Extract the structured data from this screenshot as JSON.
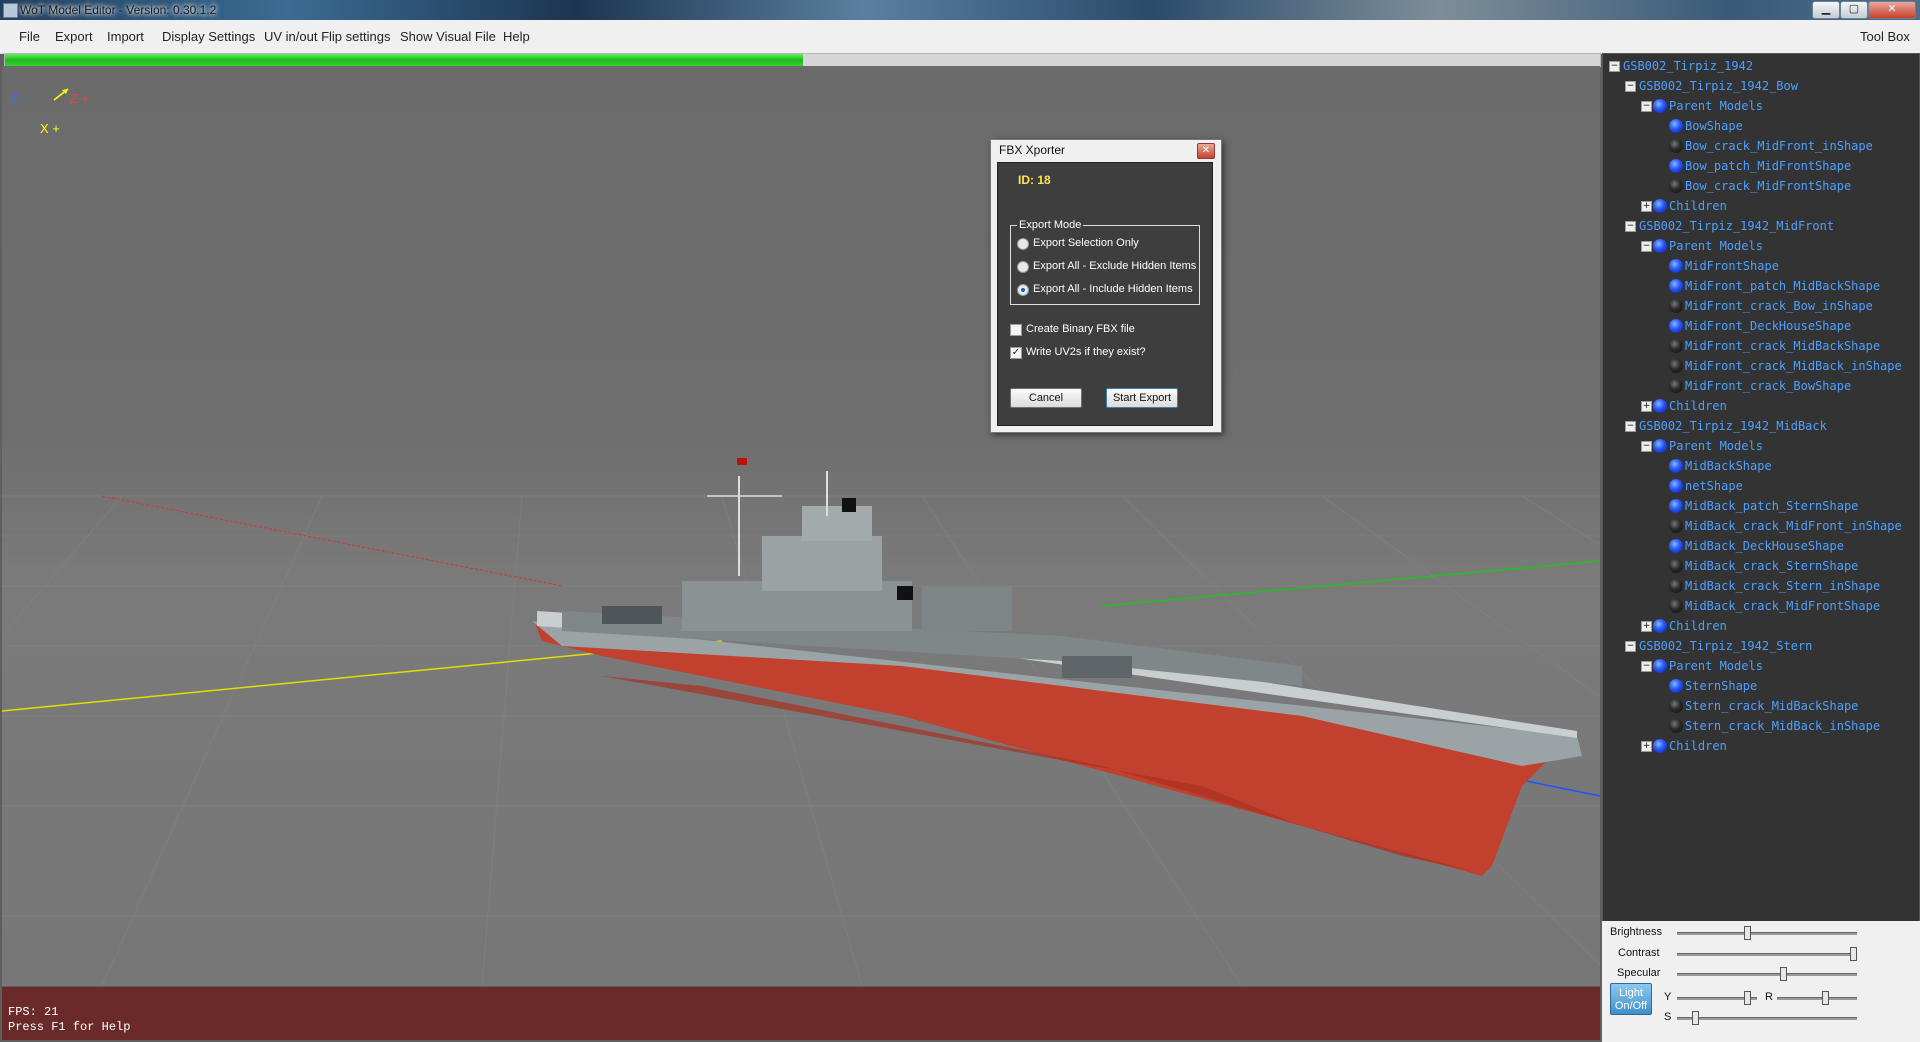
{
  "window": {
    "title": "WoT Model Editor - Version: 0.30.1.2"
  },
  "menu": {
    "items": [
      "File",
      "Export",
      "Import",
      "Display Settings",
      "UV in/out Flip settings",
      "Show Visual File",
      "Help"
    ],
    "toolbox": "Tool Box"
  },
  "progress": {
    "fraction": 0.5
  },
  "viewport": {
    "axis_z_minus": "Z -",
    "axis_z_plus": "Z +",
    "axis_x_plus": "X +",
    "fps": "FPS: 21",
    "help": "Press F1 for Help"
  },
  "dialog": {
    "title": "FBX Xporter",
    "close": "✕",
    "id_label": "ID: 18",
    "export_mode_label": "Export Mode",
    "options": [
      {
        "label": "Export Selection Only",
        "selected": false
      },
      {
        "label": "Export All - Exclude Hidden Items",
        "selected": false
      },
      {
        "label": "Export All - Include Hidden Items",
        "selected": true
      }
    ],
    "checkboxes": [
      {
        "label": "Create Binary FBX file",
        "checked": false
      },
      {
        "label": "Write UV2s if they exist?",
        "checked": true
      }
    ],
    "cancel": "Cancel",
    "start": "Start Export"
  },
  "tree": {
    "rows": [
      {
        "label": "GSB002_Tirpiz_1942",
        "level": 0,
        "exp": "−",
        "dot": "none"
      },
      {
        "label": "GSB002_Tirpiz_1942_Bow",
        "level": 1,
        "exp": "−",
        "dot": "none"
      },
      {
        "label": "Parent Models",
        "level": 2,
        "exp": "−",
        "dot": "blue"
      },
      {
        "label": "BowShape",
        "level": 3,
        "exp": "",
        "dot": "blue"
      },
      {
        "label": "Bow_crack_MidFront_inShape",
        "level": 3,
        "exp": "",
        "dot": "dark"
      },
      {
        "label": "Bow_patch_MidFrontShape",
        "level": 3,
        "exp": "",
        "dot": "blue"
      },
      {
        "label": "Bow_crack_MidFrontShape",
        "level": 3,
        "exp": "",
        "dot": "dark"
      },
      {
        "label": "Children",
        "level": 2,
        "exp": "+",
        "dot": "blue"
      },
      {
        "label": "GSB002_Tirpiz_1942_MidFront",
        "level": 1,
        "exp": "−",
        "dot": "none"
      },
      {
        "label": "Parent Models",
        "level": 2,
        "exp": "−",
        "dot": "blue"
      },
      {
        "label": "MidFrontShape",
        "level": 3,
        "exp": "",
        "dot": "blue"
      },
      {
        "label": "MidFront_patch_MidBackShape",
        "level": 3,
        "exp": "",
        "dot": "blue"
      },
      {
        "label": "MidFront_crack_Bow_inShape",
        "level": 3,
        "exp": "",
        "dot": "dark"
      },
      {
        "label": "MidFront_DeckHouseShape",
        "level": 3,
        "exp": "",
        "dot": "blue"
      },
      {
        "label": "MidFront_crack_MidBackShape",
        "level": 3,
        "exp": "",
        "dot": "dark"
      },
      {
        "label": "MidFront_crack_MidBack_inShape",
        "level": 3,
        "exp": "",
        "dot": "dark"
      },
      {
        "label": "MidFront_crack_BowShape",
        "level": 3,
        "exp": "",
        "dot": "dark"
      },
      {
        "label": "Children",
        "level": 2,
        "exp": "+",
        "dot": "blue"
      },
      {
        "label": "GSB002_Tirpiz_1942_MidBack",
        "level": 1,
        "exp": "−",
        "dot": "none"
      },
      {
        "label": "Parent Models",
        "level": 2,
        "exp": "−",
        "dot": "blue"
      },
      {
        "label": "MidBackShape",
        "level": 3,
        "exp": "",
        "dot": "blue"
      },
      {
        "label": "netShape",
        "level": 3,
        "exp": "",
        "dot": "blue"
      },
      {
        "label": "MidBack_patch_SternShape",
        "level": 3,
        "exp": "",
        "dot": "blue"
      },
      {
        "label": "MidBack_crack_MidFront_inShape",
        "level": 3,
        "exp": "",
        "dot": "dark"
      },
      {
        "label": "MidBack_DeckHouseShape",
        "level": 3,
        "exp": "",
        "dot": "blue"
      },
      {
        "label": "MidBack_crack_SternShape",
        "level": 3,
        "exp": "",
        "dot": "dark"
      },
      {
        "label": "MidBack_crack_Stern_inShape",
        "level": 3,
        "exp": "",
        "dot": "dark"
      },
      {
        "label": "MidBack_crack_MidFrontShape",
        "level": 3,
        "exp": "",
        "dot": "dark"
      },
      {
        "label": "Children",
        "level": 2,
        "exp": "+",
        "dot": "blue"
      },
      {
        "label": "GSB002_Tirpiz_1942_Stern",
        "level": 1,
        "exp": "−",
        "dot": "none"
      },
      {
        "label": "Parent Models",
        "level": 2,
        "exp": "−",
        "dot": "blue"
      },
      {
        "label": "SternShape",
        "level": 3,
        "exp": "",
        "dot": "blue"
      },
      {
        "label": "Stern_crack_MidBackShape",
        "level": 3,
        "exp": "",
        "dot": "dark"
      },
      {
        "label": "Stern_crack_MidBack_inShape",
        "level": 3,
        "exp": "",
        "dot": "dark"
      },
      {
        "label": "Children",
        "level": 2,
        "exp": "+",
        "dot": "blue"
      }
    ]
  },
  "sliders": {
    "brightness": {
      "label": "Brightness",
      "value": 0.39
    },
    "contrast": {
      "label": "Contrast",
      "value": 0.98
    },
    "specular": {
      "label": "Specular",
      "value": 0.59
    },
    "y": {
      "label": "Y",
      "value": 0.88
    },
    "r": {
      "label": "R",
      "value": 0.6
    },
    "s": {
      "label": "S",
      "value": 0.1
    },
    "light_button": "Light On/Off"
  },
  "colors": {
    "hull_red": "#c2402e",
    "hull_grey": "#9aa3a6",
    "progress_green": "#2ecc2e",
    "tree_text": "#4ea0ff"
  }
}
